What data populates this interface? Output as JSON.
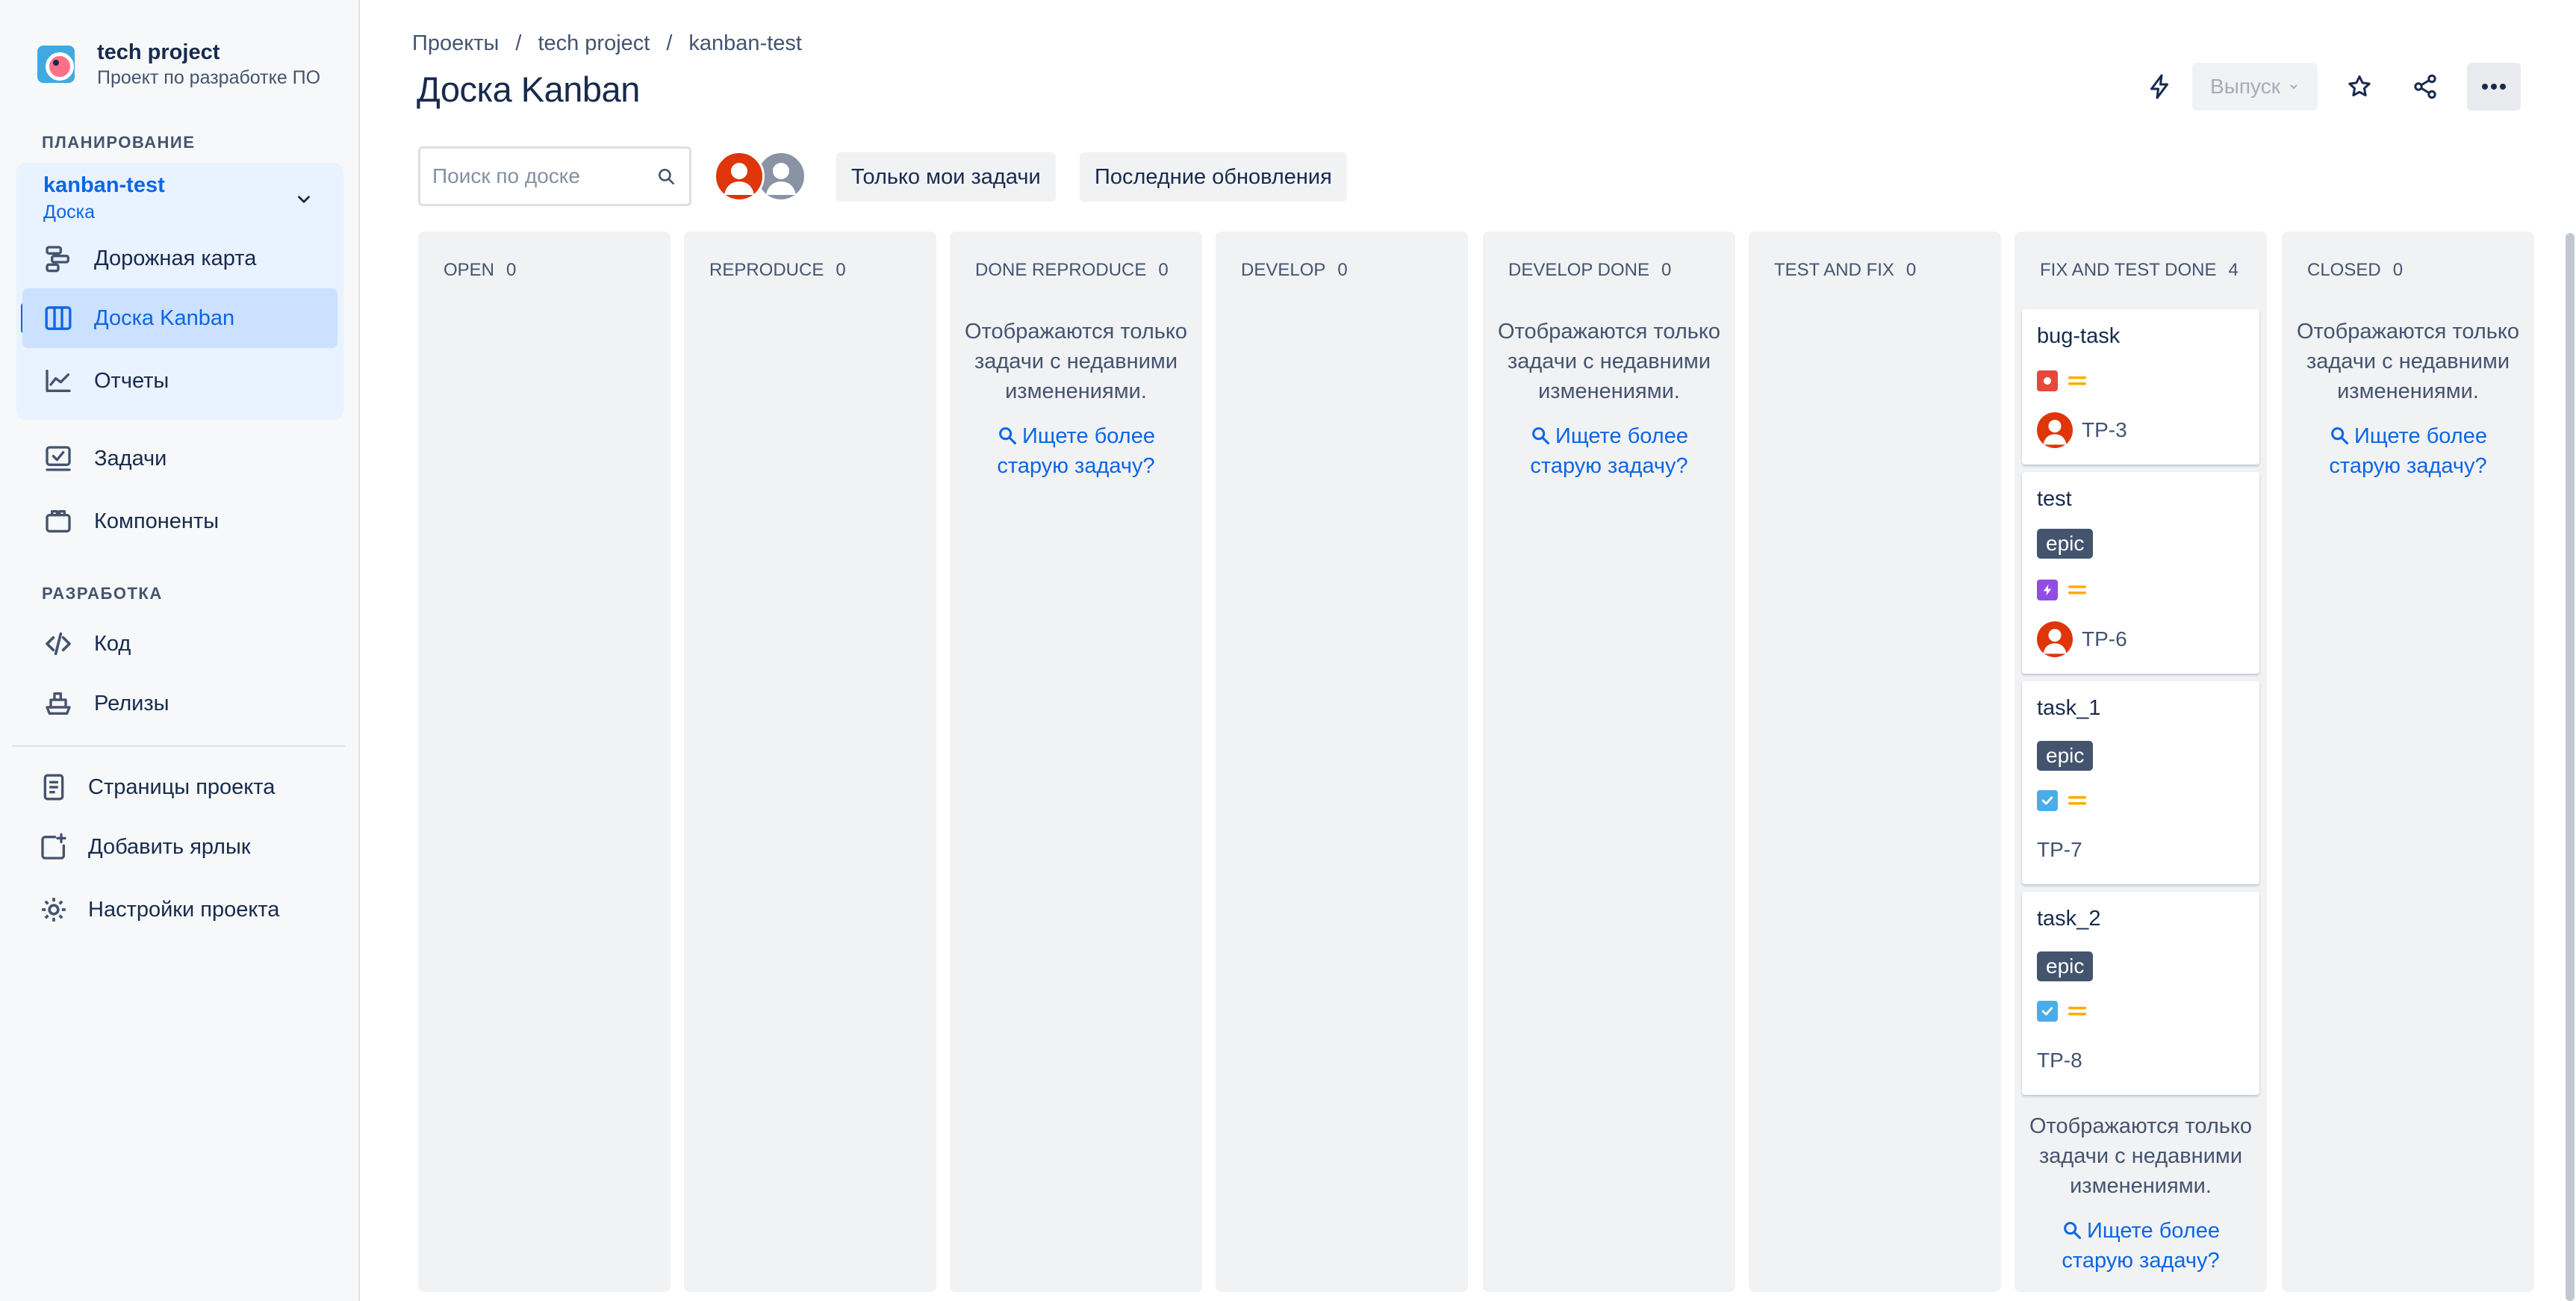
{
  "sidebar": {
    "project_name": "tech project",
    "project_sub": "Проект по разработке ПО",
    "section_planning": "ПЛАНИРОВАНИЕ",
    "board_group_title": "kanban-test",
    "board_group_sub": "Доска",
    "nav_roadmap": "Дорожная карта",
    "nav_kanban": "Доска Kanban",
    "nav_reports": "Отчеты",
    "nav_issues": "Задачи",
    "nav_components": "Компоненты",
    "section_dev": "РАЗРАБОТКА",
    "nav_code": "Код",
    "nav_releases": "Релизы",
    "nav_pages": "Страницы проекта",
    "nav_shortcut": "Добавить ярлык",
    "nav_settings": "Настройки проекта"
  },
  "breadcrumb": [
    "Проекты",
    "/",
    "tech project",
    "/",
    "kanban-test"
  ],
  "page_title": "Доска Kanban",
  "toolbar": {
    "release_label": "Выпуск",
    "search_placeholder": "Поиск по доске",
    "filter_mine": "Только мои задачи",
    "filter_recent": "Последние обновления"
  },
  "columns": [
    {
      "name": "OPEN",
      "count": "0"
    },
    {
      "name": "REPRODUCE",
      "count": "0"
    },
    {
      "name": "DONE REPRODUCE",
      "count": "0"
    },
    {
      "name": "DEVELOP",
      "count": "0"
    },
    {
      "name": "DEVELOP DONE",
      "count": "0"
    },
    {
      "name": "TEST AND FIX",
      "count": "0"
    },
    {
      "name": "FIX AND TEST DONE",
      "count": "4"
    },
    {
      "name": "CLOSED",
      "count": "0"
    }
  ],
  "column_note": {
    "line1": "Отображаются только",
    "line2": "задачи с недавними",
    "line3": "изменениями.",
    "link1": "Ищете более",
    "link2": "старую задачу?"
  },
  "cards": [
    {
      "title": "bug-task",
      "type": "bug",
      "key": "TP-3",
      "epic": ""
    },
    {
      "title": "test",
      "type": "epic",
      "key": "TP-6",
      "epic": "epic"
    },
    {
      "title": "task_1",
      "type": "task",
      "key": "TP-7",
      "epic": "epic"
    },
    {
      "title": "task_2",
      "type": "task",
      "key": "TP-8",
      "epic": "epic"
    }
  ],
  "colors": {
    "accent": "#0c66e4",
    "bug": "#e5493a",
    "epic_type": "#904ee2",
    "task_type": "#4bade8",
    "priority_medium": "#ffab00"
  }
}
